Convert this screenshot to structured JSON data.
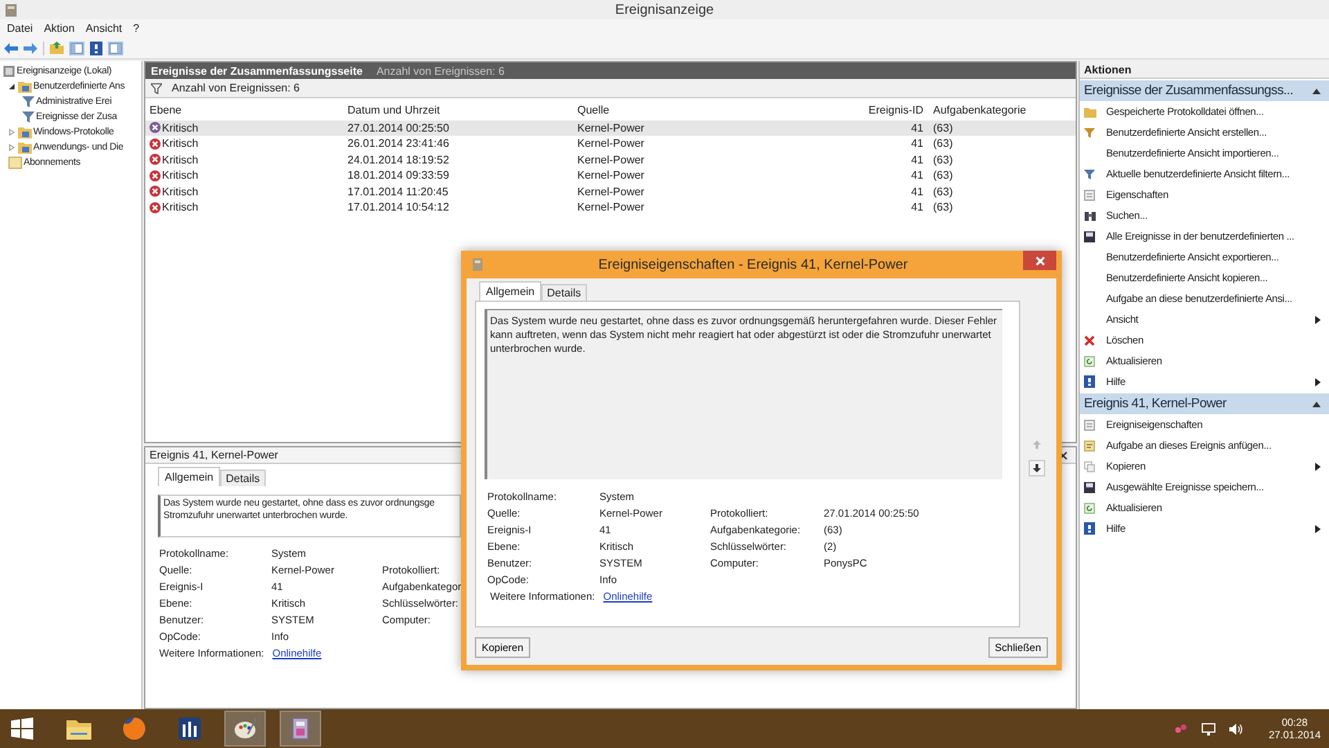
{
  "window": {
    "title": "Ereignisanzeige"
  },
  "menu": [
    "Datei",
    "Aktion",
    "Ansicht",
    "?"
  ],
  "tree": [
    {
      "label": "Ereignisanzeige (Lokal)",
      "kind": "computer",
      "children": [
        {
          "label": "Benutzerdefinierte Ans",
          "kind": "folder",
          "expanded": true,
          "children": [
            {
              "label": "Administrative Erei",
              "kind": "filter"
            },
            {
              "label": "Ereignisse der Zusa",
              "kind": "filter"
            }
          ]
        },
        {
          "label": "Windows-Protokolle",
          "kind": "folder",
          "expanded": false
        },
        {
          "label": "Anwendungs- und Die",
          "kind": "folder",
          "expanded": false
        },
        {
          "label": "Abonnements",
          "kind": "subscription"
        }
      ]
    }
  ],
  "summary": {
    "title": "Ereignisse der Zusammenfassungsseite",
    "count": "Anzahl von Ereignissen: 6",
    "filter": "Anzahl von Ereignissen: 6"
  },
  "table": {
    "columns": [
      "Ebene",
      "Datum und Uhrzeit",
      "Quelle",
      "Ereignis-ID",
      "Aufgabenkategorie"
    ],
    "rows": [
      {
        "level": "Kritisch",
        "date": "27.01.2014 00:25:50",
        "source": "Kernel-Power",
        "id": "41",
        "category": "(63)",
        "selected": true
      },
      {
        "level": "Kritisch",
        "date": "26.01.2014 23:41:46",
        "source": "Kernel-Power",
        "id": "41",
        "category": "(63)",
        "selected": false
      },
      {
        "level": "Kritisch",
        "date": "24.01.2014 18:19:52",
        "source": "Kernel-Power",
        "id": "41",
        "category": "(63)",
        "selected": false
      },
      {
        "level": "Kritisch",
        "date": "18.01.2014 09:33:59",
        "source": "Kernel-Power",
        "id": "41",
        "category": "(63)",
        "selected": false
      },
      {
        "level": "Kritisch",
        "date": "17.01.2014 11:20:45",
        "source": "Kernel-Power",
        "id": "41",
        "category": "(63)",
        "selected": false
      },
      {
        "level": "Kritisch",
        "date": "17.01.2014 10:54:12",
        "source": "Kernel-Power",
        "id": "41",
        "category": "(63)",
        "selected": false
      }
    ]
  },
  "details_pane": {
    "title": "Ereignis 41, Kernel-Power",
    "tabs": [
      {
        "label": "Allgemein",
        "selected": true
      },
      {
        "label": "Details",
        "selected": false
      }
    ],
    "description": [
      "Das System wurde neu gestartet, ohne dass es zuvor ordnungsge",
      "Stromzufuhr unerwartet unterbrochen wurde."
    ],
    "properties": [
      {
        "label": "Protokollname:",
        "value": "System"
      },
      {
        "label": "Quelle:",
        "value": "Kernel-Power",
        "label2": "Protokolliert:"
      },
      {
        "label": "Ereignis-I",
        "value": "41",
        "label2": "Aufgabenkategor"
      },
      {
        "label": "Ebene:",
        "value": "Kritisch",
        "label2": "Schlüsselwörter:"
      },
      {
        "label": "Benutzer:",
        "value": "SYSTEM",
        "label2": "Computer:"
      },
      {
        "label": "OpCode:",
        "value": "Info"
      }
    ],
    "more_info": {
      "label": "Weitere Informationen:",
      "link": "Onlinehilfe"
    }
  },
  "dialog": {
    "title": "Ereigniseigenschaften - Ereignis 41, Kernel-Power",
    "tabs": [
      {
        "label": "Allgemein",
        "selected": true
      },
      {
        "label": "Details",
        "selected": false
      }
    ],
    "description": "Das System wurde neu gestartet, ohne dass es zuvor ordnungsgemäß heruntergefahren wurde. Dieser Fehler kann auftreten, wenn das System nicht mehr reagiert hat oder abgestürzt ist oder die Stromzufuhr unerwartet unterbrochen wurde.",
    "properties": [
      {
        "label": "Protokollname:",
        "value": "System"
      },
      {
        "label": "Quelle:",
        "value": "Kernel-Power",
        "label2": "Protokolliert:",
        "value2": "27.01.2014 00:25:50"
      },
      {
        "label": "Ereignis-I",
        "value": "41",
        "label2": "Aufgabenkategorie:",
        "value2": "(63)"
      },
      {
        "label": "Ebene:",
        "value": "Kritisch",
        "label2": "Schlüsselwörter:",
        "value2": "(2)"
      },
      {
        "label": "Benutzer:",
        "value": "SYSTEM",
        "label2": "Computer:",
        "value2": "PonysPC"
      },
      {
        "label": "OpCode:",
        "value": "Info"
      }
    ],
    "more_info": {
      "label": "Weitere Informationen:",
      "link": "Onlinehilfe"
    },
    "buttons": [
      "Kopieren",
      "Schließen"
    ]
  },
  "actions": {
    "title": "Aktionen",
    "sections": [
      {
        "title": "Ereignisse der Zusammenfassungss...",
        "expanded": true,
        "items": [
          {
            "label": "Gespeicherte Protokolldatei öffnen...",
            "kind": "open",
            "submenu": false
          },
          {
            "label": "Benutzerdefinierte Ansicht erstellen...",
            "kind": "filter",
            "submenu": false
          },
          {
            "label": "Benutzerdefinierte Ansicht importieren...",
            "kind": "plain",
            "submenu": false
          },
          {
            "label": "Aktuelle benutzerdefinierte Ansicht filtern...",
            "kind": "filterblue",
            "submenu": false
          },
          {
            "label": "Eigenschaften",
            "kind": "properties",
            "submenu": false
          },
          {
            "label": "Suchen...",
            "kind": "find",
            "submenu": false
          },
          {
            "label": "Alle Ereignisse in der benutzerdefinierten ...",
            "kind": "save",
            "submenu": false
          },
          {
            "label": "Benutzerdefinierte Ansicht exportieren...",
            "kind": "plain",
            "submenu": false
          },
          {
            "label": "Benutzerdefinierte Ansicht kopieren...",
            "kind": "plain",
            "submenu": false
          },
          {
            "label": "Aufgabe an diese benutzerdefinierte Ansi...",
            "kind": "plain",
            "submenu": false
          },
          {
            "label": "Ansicht",
            "kind": "plain",
            "submenu": true
          },
          {
            "label": "Löschen",
            "kind": "delete",
            "submenu": false
          },
          {
            "label": "Aktualisieren",
            "kind": "refresh",
            "submenu": false
          },
          {
            "label": "Hilfe",
            "kind": "help",
            "submenu": true
          }
        ]
      },
      {
        "title": "Ereignis 41, Kernel-Power",
        "expanded": true,
        "items": [
          {
            "label": "Ereigniseigenschaften",
            "kind": "properties",
            "submenu": false
          },
          {
            "label": "Aufgabe an dieses Ereignis anfügen...",
            "kind": "task",
            "submenu": false
          },
          {
            "label": "Kopieren",
            "kind": "copy",
            "submenu": true
          },
          {
            "label": "Ausgewählte Ereignisse speichern...",
            "kind": "save",
            "submenu": false
          },
          {
            "label": "Aktualisieren",
            "kind": "refresh",
            "submenu": false
          },
          {
            "label": "Hilfe",
            "kind": "help",
            "submenu": true
          }
        ]
      }
    ]
  },
  "taskbar": {
    "apps": [
      {
        "kind": "folder",
        "open": false
      },
      {
        "kind": "browser",
        "open": false
      },
      {
        "kind": "equalizer",
        "open": false
      },
      {
        "kind": "palette",
        "open": true
      },
      {
        "kind": "viewer",
        "open": true
      }
    ],
    "time": "00:28",
    "date": "27.01.2014"
  }
}
